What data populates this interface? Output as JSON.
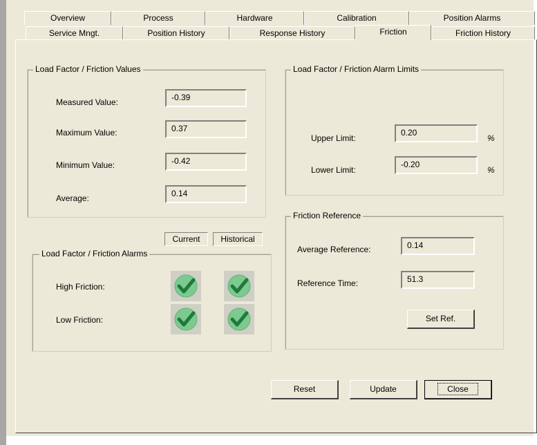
{
  "tabs_row1": [
    "Overview",
    "Process",
    "Hardware",
    "Calibration",
    "Position Alarms"
  ],
  "tabs_row2": [
    "Service Mngt.",
    "Position History",
    "Response History",
    "Friction",
    "Friction History"
  ],
  "active_tab": "Friction",
  "values_group": {
    "title": "Load Factor / Friction  Values",
    "measured_label": "Measured Value:",
    "measured_value": "-0.39",
    "maximum_label": "Maximum Value:",
    "maximum_value": "0.37",
    "minimum_label": "Minimum Value:",
    "minimum_value": "-0.42",
    "average_label": "Average:",
    "average_value": "0.14"
  },
  "limits_group": {
    "title": "Load Factor / Friction Alarm Limits",
    "upper_label": "Upper Limit:",
    "upper_value": "0.20",
    "upper_unit": "%",
    "lower_label": "Lower Limit:",
    "lower_value": "-0.20",
    "lower_unit": "%"
  },
  "alarms_group": {
    "title": "Load Factor / Friction Alarms",
    "col_current": "Current",
    "col_historical": "Historical",
    "high_label": "High Friction:",
    "low_label": "Low Friction:",
    "indicator_icon": "green-check-icon",
    "indicator_color": "#2e9a4a"
  },
  "reference_group": {
    "title": "Friction Reference",
    "avg_ref_label": "Average Reference:",
    "avg_ref_value": "0.14",
    "ref_time_label": "Reference Time:",
    "ref_time_value": "51.3",
    "set_ref_button": "Set Ref."
  },
  "buttons": {
    "reset": "Reset",
    "update": "Update",
    "close": "Close"
  }
}
